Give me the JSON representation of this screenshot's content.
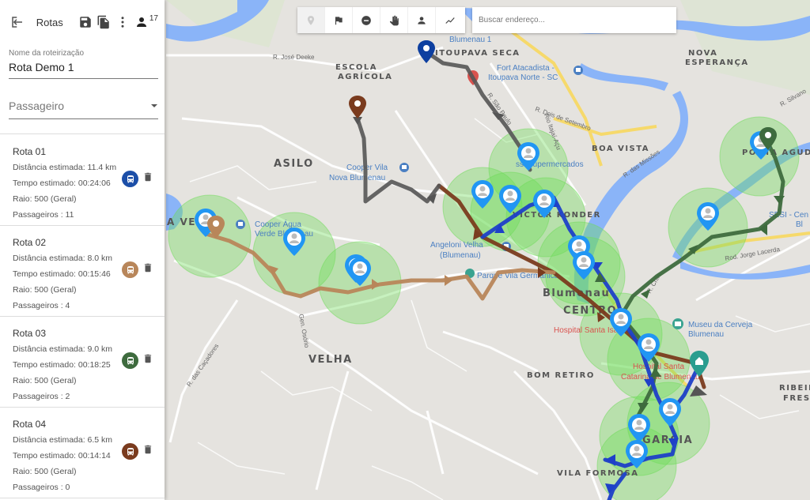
{
  "panel": {
    "title": "Rotas",
    "user_count": "17",
    "name_label": "Nome da roteirização",
    "name_value": "Rota Demo 1",
    "passenger_placeholder": "Passageiro"
  },
  "routes": [
    {
      "name": "Rota 01",
      "distance": "Distância estimada: 11.4 km",
      "time": "Tempo estimado: 00:24:06",
      "radius": "Raio: 500 (Geral)",
      "passengers": "Passageiros : 11",
      "color": "#1c4fa8"
    },
    {
      "name": "Rota 02",
      "distance": "Distância estimada: 8.0 km",
      "time": "Tempo estimado: 00:15:46",
      "radius": "Raio: 500 (Geral)",
      "passengers": "Passageiros : 4",
      "color": "#b8865a"
    },
    {
      "name": "Rota 03",
      "distance": "Distância estimada: 9.0 km",
      "time": "Tempo estimado: 00:18:25",
      "radius": "Raio: 500 (Geral)",
      "passengers": "Passageiros : 2",
      "color": "#3e6b3e"
    },
    {
      "name": "Rota 04",
      "distance": "Distância estimada: 6.5 km",
      "time": "Tempo estimado: 00:14:14",
      "radius": "Raio: 500 (Geral)",
      "passengers": "Passageiros : 0",
      "color": "#7a3b1e"
    }
  ],
  "toolbar": {
    "tools": [
      "marker-icon",
      "flag-icon",
      "minus-circle-icon",
      "hand-icon",
      "person-icon",
      "route-line-icon"
    ],
    "search_placeholder": "Buscar endereço..."
  },
  "map": {
    "neighborhoods": {
      "asilo": "ASILO",
      "velha": "VELHA",
      "garcia": "GARCIA",
      "bom_retiro": "BOM RETIRO",
      "boa_vista": "BOA VISTA",
      "escola_agricola_1": "ESCOLA",
      "escola_agricola_2": "AGRÍCOLA",
      "nova_esperanca_1": "NOVA",
      "nova_esperanca_2": "ESPERANÇA",
      "vila_formosa": "VILA FORMOSA",
      "itoupava_seca": "ITOUPAVA SECA",
      "ponta_aguda": "PONTA AGUDA",
      "ribeirao_fresco_1": "RIBEIR",
      "ribeirao_fresco_2": "FRESC",
      "centro_1": "Blumenau",
      "centro_2": "CENTRO",
      "victor_konder": "VICTOR KONDER",
      "agua_verde": "A VE"
    },
    "pois": {
      "fort_atacadista_1": "Fort Atacadista -",
      "fort_atacadista_2": "Itoupava Norte - SC",
      "cooper_vila_1": "Cooper Vila",
      "cooper_vila_2": "Nova Blumenau",
      "cooper_agua_1": "Cooper Água",
      "cooper_agua_2": "Verde Blumenau",
      "angeloni_1": "Angeloni Velha",
      "angeloni_2": "(Blumenau)",
      "parque": "Parque Vila Germânica",
      "museu_1": "Museu da Cerveja",
      "museu_2": "Blumenau",
      "hospital_santa_isabel": "Hospital Santa Isabel",
      "hospital_santa_catarina_1": "Hospital Santa",
      "hospital_santa_catarina_2": "Catarina de Blumenau",
      "supermercados": "ssi Supermercados",
      "blumenau_top": "Blumenau 1",
      "sesi": "SESI - Cen",
      "sesi2": "Bl"
    },
    "roads": {
      "jose_deeke": "R. José Deeke",
      "sao_paulo": "R. São Paulo",
      "dois_setembro": "R. Dois de Setembro",
      "jorge_lacerda": "Rod. Jorge Lacerda",
      "cacadores": "R. das Caçadores",
      "missoes": "R. das Missões",
      "chile": "R. Chile",
      "rio_itajai": "Rio Itajaí-Açu",
      "silvano": "R. Silvano",
      "gen_osorio": "Gen. Osório"
    }
  }
}
